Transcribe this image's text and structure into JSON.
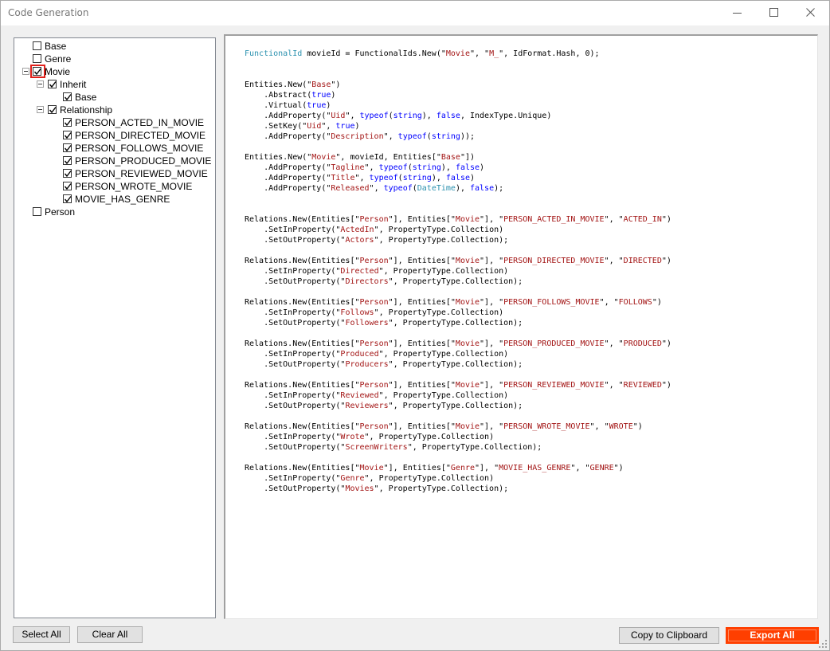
{
  "window": {
    "title": "Code Generation"
  },
  "tree": {
    "nodes": [
      {
        "label": "Base",
        "checked": false
      },
      {
        "label": "Genre",
        "checked": false
      },
      {
        "label": "Movie",
        "checked": true,
        "expanded": true,
        "highlighted": true
      },
      {
        "label": "Inherit",
        "checked": true,
        "expanded": true
      },
      {
        "label": "Base",
        "checked": true
      },
      {
        "label": "Relationship",
        "checked": true,
        "expanded": true
      },
      {
        "label": "PERSON_ACTED_IN_MOVIE",
        "checked": true
      },
      {
        "label": "PERSON_DIRECTED_MOVIE",
        "checked": true
      },
      {
        "label": "PERSON_FOLLOWS_MOVIE",
        "checked": true
      },
      {
        "label": "PERSON_PRODUCED_MOVIE",
        "checked": true
      },
      {
        "label": "PERSON_REVIEWED_MOVIE",
        "checked": true
      },
      {
        "label": "PERSON_WROTE_MOVIE",
        "checked": true
      },
      {
        "label": "MOVIE_HAS_GENRE",
        "checked": true
      },
      {
        "label": "Person",
        "checked": false
      }
    ]
  },
  "code": {
    "lines": [
      "FunctionalId movieId = FunctionalIds.New(\"Movie\", \"M_\", IdFormat.Hash, 0);",
      "",
      "",
      "Entities.New(\"Base\")",
      "    .Abstract(true)",
      "    .Virtual(true)",
      "    .AddProperty(\"Uid\", typeof(string), false, IndexType.Unique)",
      "    .SetKey(\"Uid\", true)",
      "    .AddProperty(\"Description\", typeof(string));",
      "",
      "Entities.New(\"Movie\", movieId, Entities[\"Base\"])",
      "    .AddProperty(\"Tagline\", typeof(string), false)",
      "    .AddProperty(\"Title\", typeof(string), false)",
      "    .AddProperty(\"Released\", typeof(DateTime), false);",
      "",
      "",
      "Relations.New(Entities[\"Person\"], Entities[\"Movie\"], \"PERSON_ACTED_IN_MOVIE\", \"ACTED_IN\")",
      "    .SetInProperty(\"ActedIn\", PropertyType.Collection)",
      "    .SetOutProperty(\"Actors\", PropertyType.Collection);",
      "",
      "Relations.New(Entities[\"Person\"], Entities[\"Movie\"], \"PERSON_DIRECTED_MOVIE\", \"DIRECTED\")",
      "    .SetInProperty(\"Directed\", PropertyType.Collection)",
      "    .SetOutProperty(\"Directors\", PropertyType.Collection);",
      "",
      "Relations.New(Entities[\"Person\"], Entities[\"Movie\"], \"PERSON_FOLLOWS_MOVIE\", \"FOLLOWS\")",
      "    .SetInProperty(\"Follows\", PropertyType.Collection)",
      "    .SetOutProperty(\"Followers\", PropertyType.Collection);",
      "",
      "Relations.New(Entities[\"Person\"], Entities[\"Movie\"], \"PERSON_PRODUCED_MOVIE\", \"PRODUCED\")",
      "    .SetInProperty(\"Produced\", PropertyType.Collection)",
      "    .SetOutProperty(\"Producers\", PropertyType.Collection);",
      "",
      "Relations.New(Entities[\"Person\"], Entities[\"Movie\"], \"PERSON_REVIEWED_MOVIE\", \"REVIEWED\")",
      "    .SetInProperty(\"Reviewed\", PropertyType.Collection)",
      "    .SetOutProperty(\"Reviewers\", PropertyType.Collection);",
      "",
      "Relations.New(Entities[\"Person\"], Entities[\"Movie\"], \"PERSON_WROTE_MOVIE\", \"WROTE\")",
      "    .SetInProperty(\"Wrote\", PropertyType.Collection)",
      "    .SetOutProperty(\"ScreenWriters\", PropertyType.Collection);",
      "",
      "Relations.New(Entities[\"Movie\"], Entities[\"Genre\"], \"MOVIE_HAS_GENRE\", \"GENRE\")",
      "    .SetInProperty(\"Genre\", PropertyType.Collection)",
      "    .SetOutProperty(\"Movies\", PropertyType.Collection);"
    ]
  },
  "buttons": {
    "select_all": "Select All",
    "clear_all": "Clear All",
    "copy_to_clipboard": "Copy to Clipboard",
    "export_all": "Export All"
  },
  "colors": {
    "highlight_border": "#e0201b",
    "export_button": "#ff3f00",
    "code_type": "#2b91af",
    "code_string": "#a31515",
    "code_keyword": "#0000ff"
  }
}
